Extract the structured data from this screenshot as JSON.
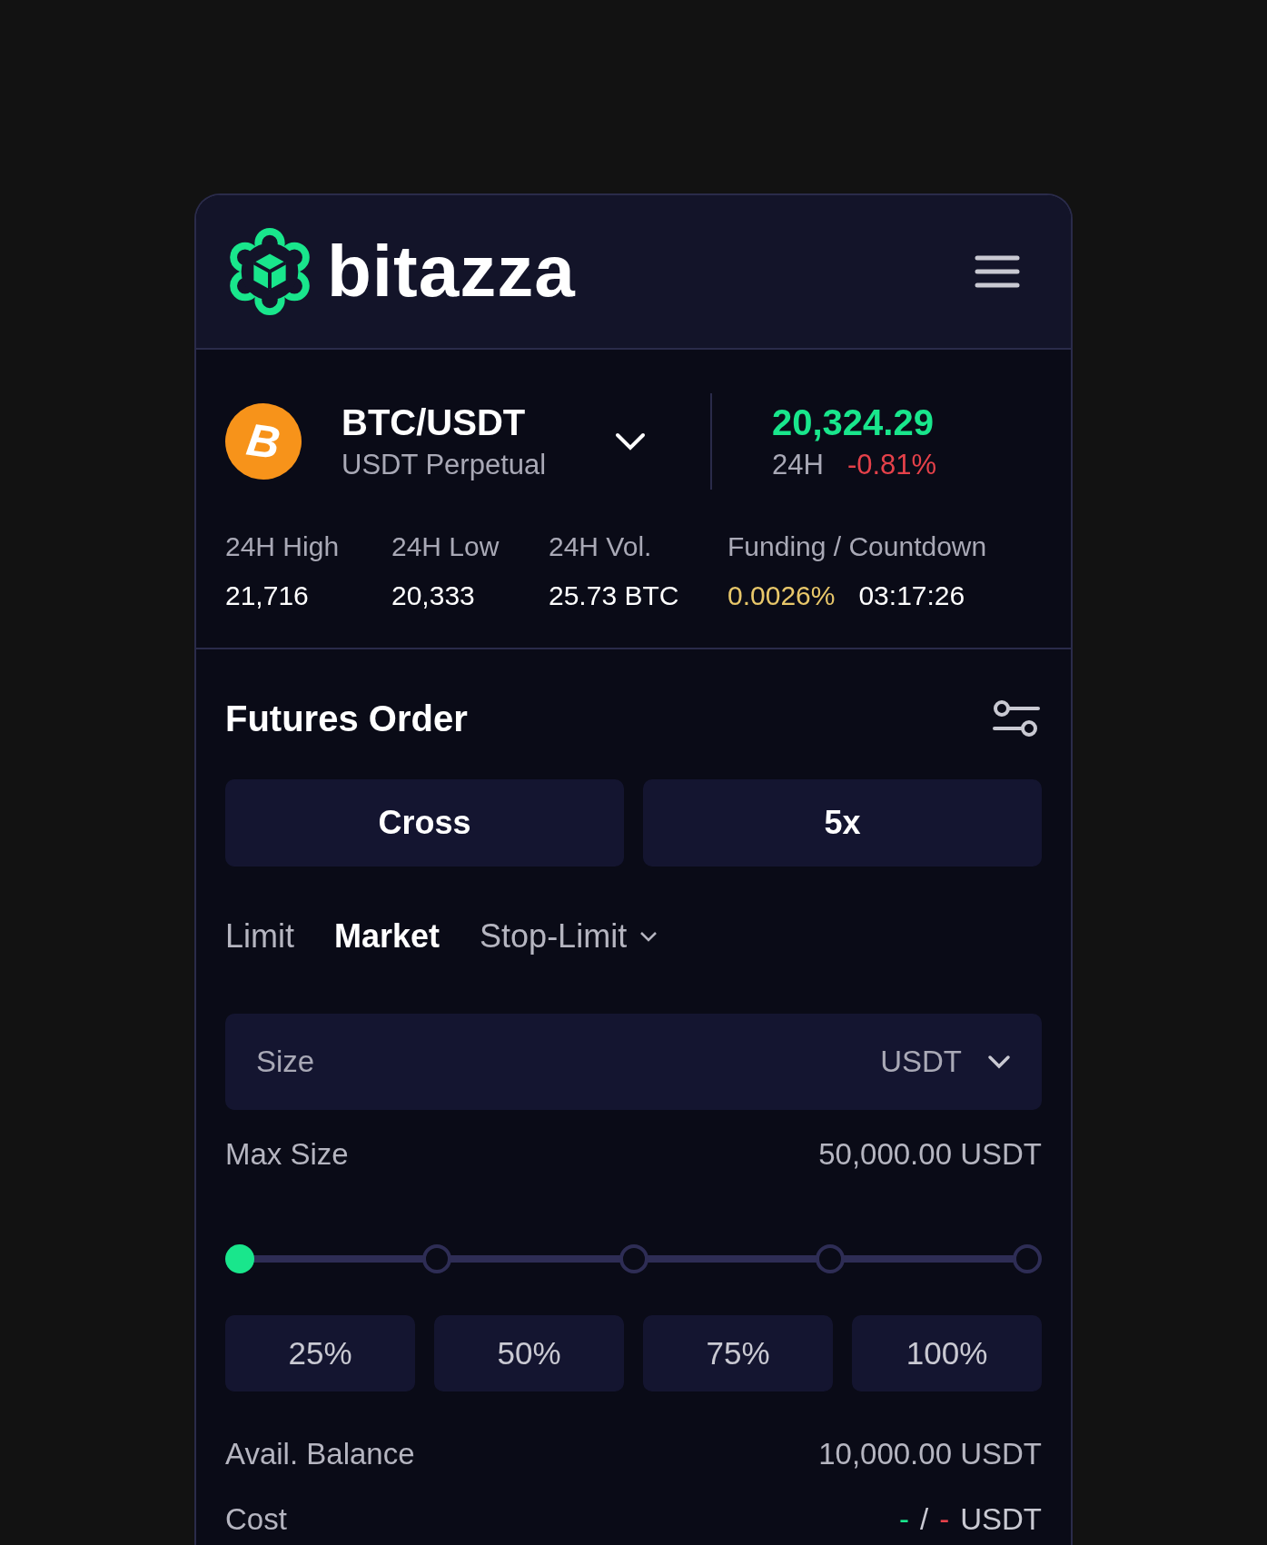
{
  "header": {
    "brand": "bitazza"
  },
  "ticker": {
    "coin_letter": "B",
    "pair": "BTC/USDT",
    "contract": "USDT Perpetual",
    "price": "20,324.29",
    "change_label": "24H",
    "change": "-0.81%",
    "stats": [
      {
        "label": "24H High",
        "values": [
          {
            "text": "21,716",
            "kind": "plain"
          }
        ]
      },
      {
        "label": "24H Low",
        "values": [
          {
            "text": "20,333",
            "kind": "plain"
          }
        ]
      },
      {
        "label": "24H Vol.",
        "values": [
          {
            "text": "25.73 BTC",
            "kind": "plain"
          }
        ]
      },
      {
        "label": "Funding / Countdown",
        "values": [
          {
            "text": "0.0026%",
            "kind": "rate"
          },
          {
            "text": "03:17:26",
            "kind": "plain"
          }
        ]
      }
    ]
  },
  "order": {
    "title": "Futures Order",
    "mode_buttons": [
      "Cross",
      "5x"
    ],
    "tabs": [
      {
        "label": "Limit",
        "selected": false,
        "kind": "plain"
      },
      {
        "label": "Market",
        "selected": true,
        "kind": "plain"
      },
      {
        "label": "Stop-Limit",
        "selected": false,
        "kind": "dropdown"
      }
    ],
    "size_field": {
      "placeholder": "Size",
      "unit": "USDT"
    },
    "max_size": {
      "label": "Max Size",
      "value": "50,000.00 USDT"
    },
    "slider": {
      "level": 0
    },
    "percent_buttons": [
      "25%",
      "50%",
      "75%",
      "100%"
    ],
    "balance": {
      "label": "Avail. Balance",
      "value": "10,000.00 USDT"
    },
    "cost": {
      "label": "Cost",
      "parts": [
        {
          "text": "-",
          "kind": "long"
        },
        {
          "text": "/",
          "kind": "plain"
        },
        {
          "text": "-",
          "kind": "short"
        },
        {
          "text": "USDT",
          "kind": "plain"
        }
      ]
    }
  }
}
